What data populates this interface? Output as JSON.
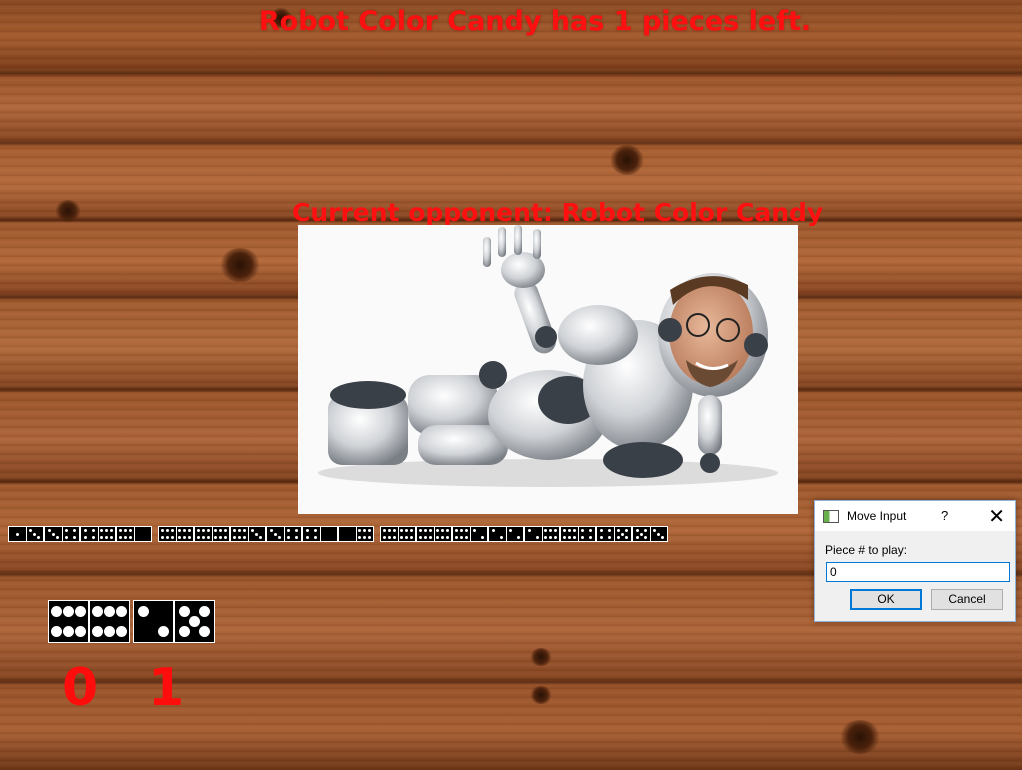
{
  "status": {
    "pieces_left_text": "Robot Color Candy has 1 pieces left."
  },
  "opponent": {
    "label": "Current opponent: Robot Color Candy"
  },
  "player_hand": {
    "tiles": [
      [
        6,
        6
      ],
      [
        2,
        5
      ]
    ]
  },
  "scores": {
    "player": "0",
    "opponent": "1"
  },
  "played_line": [
    [
      1,
      3
    ],
    [
      3,
      4
    ],
    [
      4,
      6
    ],
    [
      6,
      0
    ],
    [
      6,
      6
    ],
    [
      6,
      6
    ],
    [
      6,
      3
    ],
    [
      3,
      4
    ],
    [
      4,
      0
    ],
    [
      0,
      6
    ],
    [
      6,
      6
    ],
    [
      6,
      6
    ],
    [
      6,
      2
    ],
    [
      2,
      2
    ],
    [
      2,
      6
    ],
    [
      6,
      4
    ],
    [
      4,
      5
    ],
    [
      5,
      3
    ]
  ],
  "dialog": {
    "title": "Move Input",
    "help_glyph": "?",
    "close_glyph": "✕",
    "prompt": "Piece # to play:",
    "input_value": "0",
    "ok_label": "OK",
    "cancel_label": "Cancel"
  },
  "colors": {
    "text_red": "#ff1010",
    "dialog_focus": "#0078d7"
  },
  "icons": {
    "dialog_app_icon": "app-window-icon"
  }
}
